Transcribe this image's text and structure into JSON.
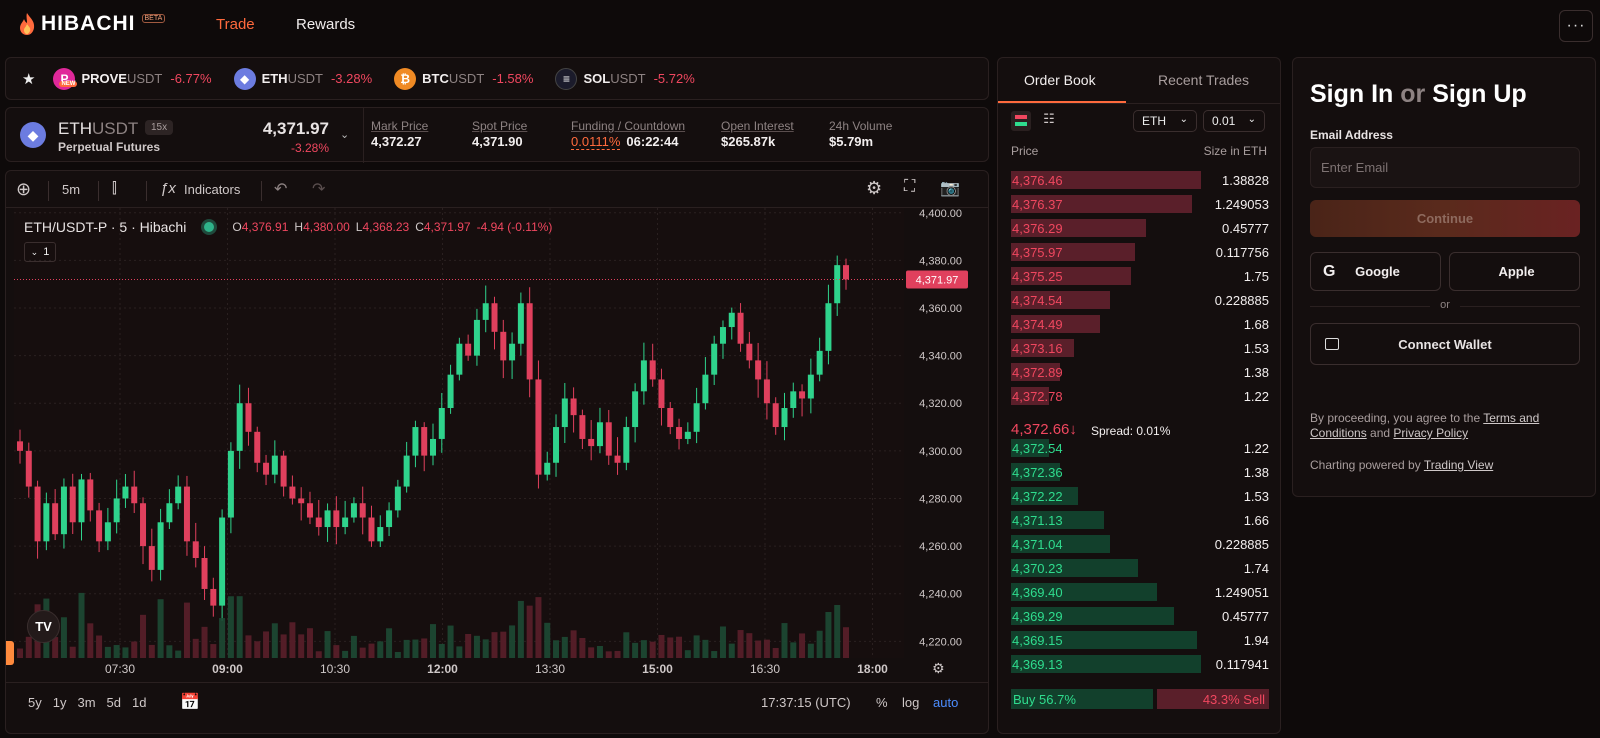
{
  "nav": {
    "logo": "HIBACHI",
    "beta": "BETA",
    "trade": "Trade",
    "rewards": "Rewards",
    "more_icon": "ellipsis-icon"
  },
  "ticker": [
    {
      "sym": "PROVE",
      "quote": "USDT",
      "chg": "-6.77%",
      "badge": "NEW",
      "color": "#e0289a",
      "glyph": "P"
    },
    {
      "sym": "ETH",
      "quote": "USDT",
      "chg": "-3.28%",
      "color": "#6c7ce0",
      "glyph": "◆"
    },
    {
      "sym": "BTC",
      "quote": "USDT",
      "chg": "-1.58%",
      "color": "#f08a24",
      "glyph": "₿"
    },
    {
      "sym": "SOL",
      "quote": "USDT",
      "chg": "-5.72%",
      "color": "#1b1b2b",
      "glyph": "≡"
    }
  ],
  "market": {
    "base": "ETH",
    "quote": "USDT",
    "leverage": "15x",
    "type": "Perpetual Futures",
    "price": "4,371.97",
    "change": "-3.28%",
    "mark_label": "Mark Price",
    "mark_value": "4,372.27",
    "spot_label": "Spot Price",
    "spot_value": "4,371.90",
    "funding_label": "Funding / Countdown",
    "funding_rate": "0.0111%",
    "funding_countdown": "06:22:44",
    "oi_label": "Open Interest",
    "oi_value": "$265.87k",
    "vol_label": "24h Volume",
    "vol_value": "$5.79m"
  },
  "chart_toolbar": {
    "interval": "5m",
    "indicators": "Indicators"
  },
  "chart_legend": {
    "title": "ETH/USDT-P · 5 · Hibachi",
    "o_label": "O",
    "o": "4,376.91",
    "h_label": "H",
    "h": "4,380.00",
    "l_label": "L",
    "l": "4,368.23",
    "c_label": "C",
    "c": "4,371.97",
    "chg": "-4.94 (-0.11%)",
    "collapse": "1"
  },
  "chart_bottom": {
    "ranges": [
      "5y",
      "1y",
      "3m",
      "5d",
      "1d"
    ],
    "time": "17:37:15 (UTC)",
    "pct": "%",
    "log": "log",
    "auto": "auto"
  },
  "chart_data": {
    "type": "candlestick",
    "yticks": [
      4220,
      4240,
      4260,
      4280,
      4300,
      4320,
      4340,
      4360,
      4380,
      4400
    ],
    "ytick_labels": [
      "4,220.00",
      "4,240.00",
      "4,260.00",
      "4,280.00",
      "4,300.00",
      "4,320.00",
      "4,340.00",
      "4,360.00",
      "4,380.00",
      "4,400.00"
    ],
    "xticks": [
      "07:30",
      "09:00",
      "10:30",
      "12:00",
      "13:30",
      "15:00",
      "16:30",
      "18:00"
    ],
    "last_price": 4371.97,
    "last_price_label": "4,371.97",
    "close_path": [
      4300,
      4285,
      4262,
      4278,
      4265,
      4285,
      4270,
      4288,
      4275,
      4262,
      4270,
      4280,
      4285,
      4278,
      4260,
      4250,
      4270,
      4278,
      4285,
      4262,
      4255,
      4242,
      4235,
      4272,
      4300,
      4320,
      4308,
      4295,
      4290,
      4298,
      4285,
      4280,
      4278,
      4272,
      4268,
      4275,
      4268,
      4272,
      4278,
      4272,
      4262,
      4268,
      4275,
      4285,
      4298,
      4310,
      4298,
      4305,
      4318,
      4332,
      4345,
      4340,
      4355,
      4362,
      4350,
      4338,
      4345,
      4362,
      4330,
      4290,
      4295,
      4310,
      4322,
      4315,
      4305,
      4302,
      4312,
      4298,
      4295,
      4310,
      4325,
      4338,
      4330,
      4318,
      4310,
      4305,
      4308,
      4320,
      4332,
      4345,
      4352,
      4358,
      4345,
      4338,
      4330,
      4320,
      4310,
      4318,
      4325,
      4322,
      4332,
      4342,
      4362,
      4378,
      4372
    ]
  },
  "orderbook": {
    "tab_book": "Order Book",
    "tab_trades": "Recent Trades",
    "asset": "ETH",
    "tick": "0.01",
    "h_price": "Price",
    "h_size": "Size in ETH",
    "asks": [
      {
        "p": "4,376.46",
        "s": "1.38828",
        "d": 1.0
      },
      {
        "p": "4,376.37",
        "s": "1.249053",
        "d": 0.95
      },
      {
        "p": "4,376.29",
        "s": "0.45777",
        "d": 0.71
      },
      {
        "p": "4,375.97",
        "s": "0.117756",
        "d": 0.65
      },
      {
        "p": "4,375.25",
        "s": "1.75",
        "d": 0.63
      },
      {
        "p": "4,374.54",
        "s": "0.228885",
        "d": 0.52
      },
      {
        "p": "4,374.49",
        "s": "1.68",
        "d": 0.47
      },
      {
        "p": "4,373.16",
        "s": "1.53",
        "d": 0.33
      },
      {
        "p": "4,372.89",
        "s": "1.38",
        "d": 0.26
      },
      {
        "p": "4,372.78",
        "s": "1.22",
        "d": 0.2
      }
    ],
    "mid": "4,372.66↓",
    "spread": "Spread: 0.01%",
    "bids": [
      {
        "p": "4,372.54",
        "s": "1.22",
        "d": 0.2
      },
      {
        "p": "4,372.36",
        "s": "1.38",
        "d": 0.26
      },
      {
        "p": "4,372.22",
        "s": "1.53",
        "d": 0.35
      },
      {
        "p": "4,371.13",
        "s": "1.66",
        "d": 0.49
      },
      {
        "p": "4,371.04",
        "s": "0.228885",
        "d": 0.52
      },
      {
        "p": "4,370.23",
        "s": "1.74",
        "d": 0.67
      },
      {
        "p": "4,369.40",
        "s": "1.249051",
        "d": 0.77
      },
      {
        "p": "4,369.29",
        "s": "0.45777",
        "d": 0.86
      },
      {
        "p": "4,369.15",
        "s": "1.94",
        "d": 0.98
      },
      {
        "p": "4,369.13",
        "s": "0.117941",
        "d": 1.0
      }
    ],
    "buy": "Buy 56.7%",
    "buy_pct": 56.7,
    "sell": "43.3% Sell"
  },
  "auth": {
    "title_a": "Sign In",
    "title_or": "or",
    "title_b": "Sign Up",
    "email_label": "Email Address",
    "email_placeholder": "Enter Email",
    "continue": "Continue",
    "google": "Google",
    "apple": "Apple",
    "or": "or",
    "wallet": "Connect Wallet",
    "terms_pre": "By proceeding, you agree to the",
    "terms_link": "Terms and Conditions",
    "terms_and": "and",
    "privacy_link": "Privacy Policy",
    "chart_pre": "Charting powered by",
    "chart_link": "Trading View"
  }
}
